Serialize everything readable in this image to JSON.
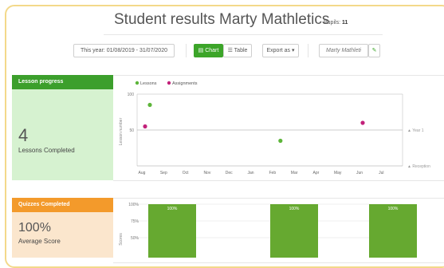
{
  "header": {
    "title": "Student results Marty Mathletics",
    "pupils_label": "Pupils:",
    "pupils_count": "11"
  },
  "toolbar": {
    "date_range": "This year: 01/08/2019 - 31/07/2020",
    "chart_label": "Chart",
    "table_label": "Table",
    "export_label": "Export as ▾",
    "user_label": "Marty Mathleti"
  },
  "lesson_panel": {
    "title": "Lesson progress",
    "count": "4",
    "caption": "Lessons Completed",
    "color": "#3c9f2c"
  },
  "quiz_panel": {
    "title": "Quizzes Completed",
    "score": "100%",
    "caption": "Average Score",
    "color": "#f39a2b"
  },
  "chart_data": [
    {
      "type": "scatter",
      "legend": [
        "Lessons",
        "Assignments"
      ],
      "legend_colors": [
        "#5db53a",
        "#c2217a"
      ],
      "ylabel": "Lesson number",
      "y_ticks": [
        "100",
        "50"
      ],
      "ylim": [
        0,
        100
      ],
      "x_categories": [
        "Aug",
        "Sep",
        "Oct",
        "Nov",
        "Dec",
        "Jan",
        "Feb",
        "Mar",
        "Apr",
        "May",
        "Jun",
        "Jul"
      ],
      "series": [
        {
          "name": "Lessons",
          "points": [
            {
              "x": "Aug",
              "y": 85
            },
            {
              "x": "Feb",
              "y": 35
            }
          ]
        },
        {
          "name": "Assignments",
          "points": [
            {
              "x": "Aug",
              "y": 55
            },
            {
              "x": "Jun",
              "y": 60
            }
          ]
        }
      ],
      "reference_lines": [
        {
          "label": "Year 1",
          "y": 50
        },
        {
          "label": "Reception",
          "y": 0
        }
      ]
    },
    {
      "type": "bar",
      "ylabel": "Scores",
      "y_ticks": [
        "100%",
        "75%",
        "50%"
      ],
      "ylim": [
        0,
        100
      ],
      "bar_color": "#66a930",
      "values": [
        100,
        100,
        100
      ],
      "value_labels": [
        "100%",
        "100%",
        "100%"
      ]
    }
  ]
}
